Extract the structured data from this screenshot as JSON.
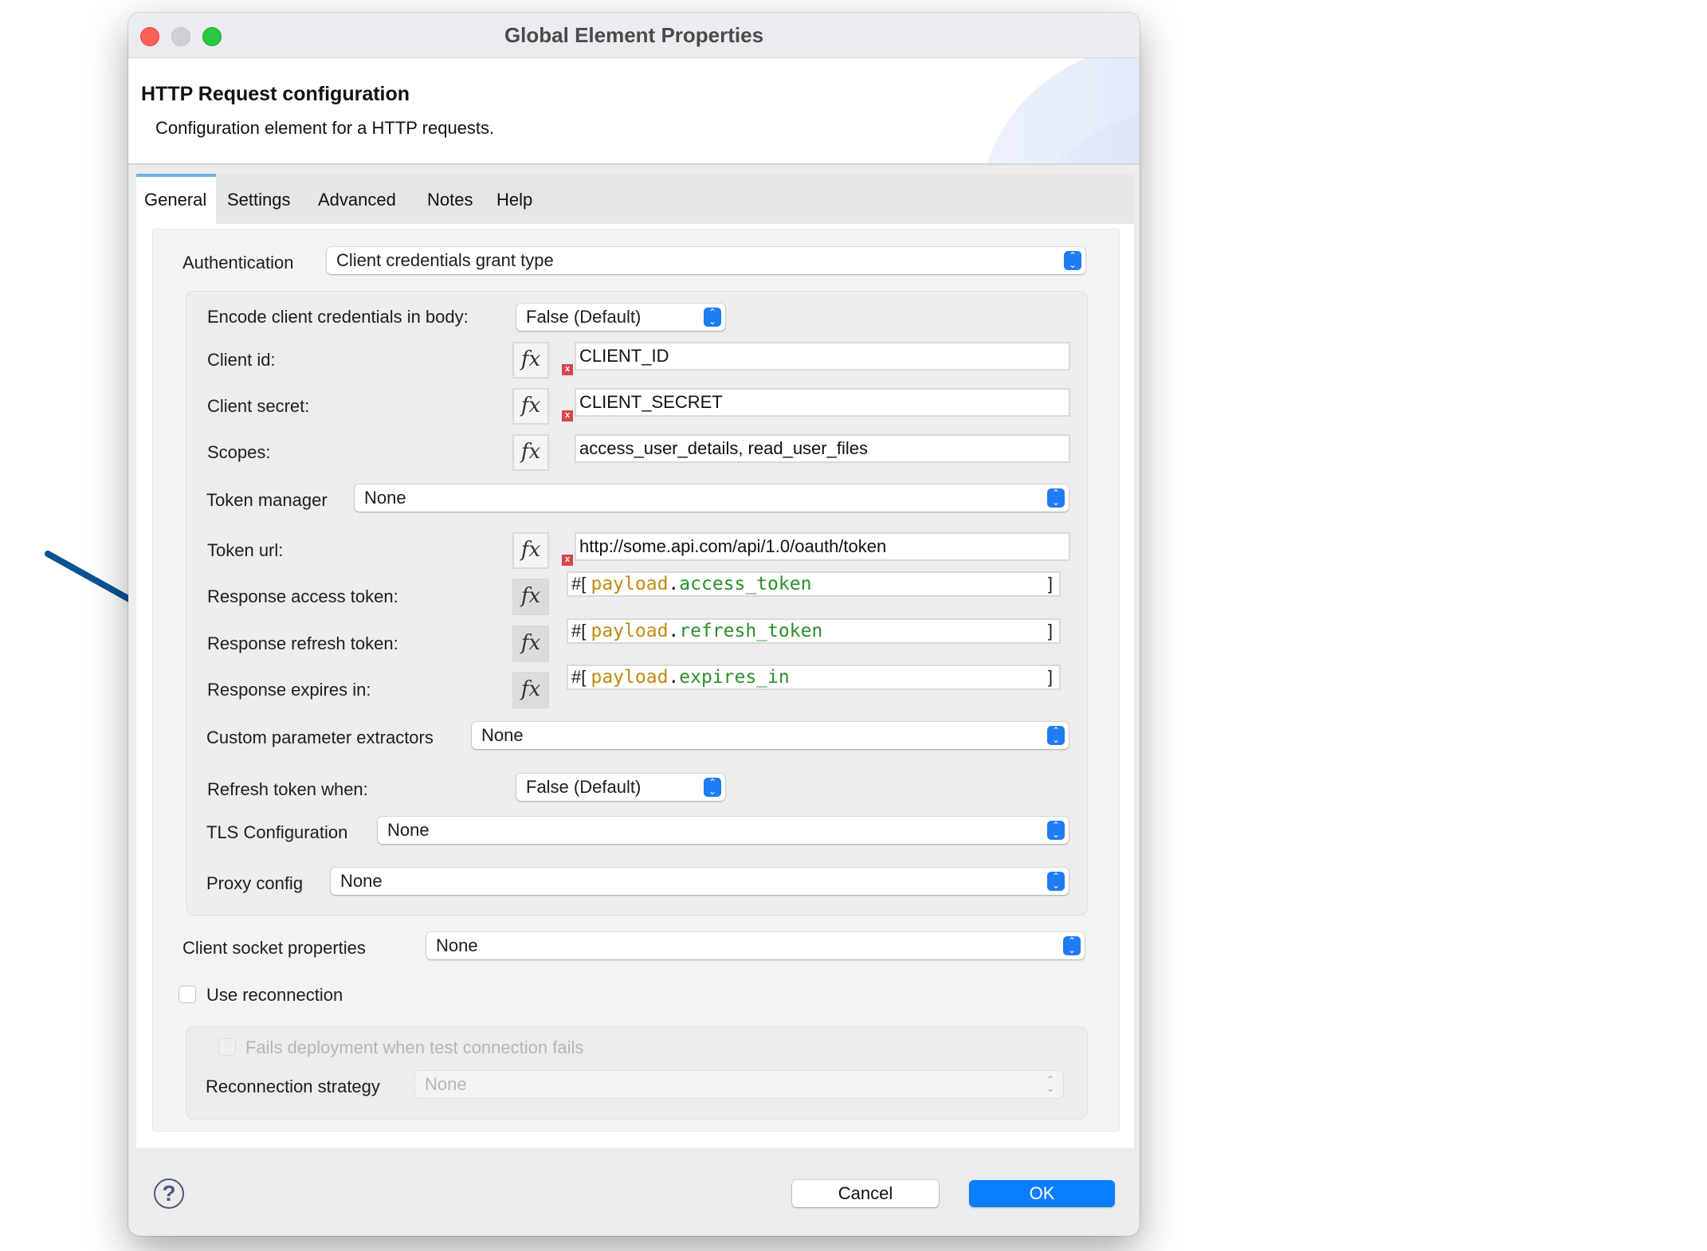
{
  "window": {
    "title": "Global Element Properties",
    "traffic_lights": {
      "close": "#fe5f57",
      "minimize": "#d0d0d4",
      "zoom": "#28c840"
    }
  },
  "header": {
    "title": "HTTP Request configuration",
    "subtitle": "Configuration element for a HTTP requests."
  },
  "tabs": [
    {
      "label": "General",
      "active": true
    },
    {
      "label": "Settings",
      "active": false
    },
    {
      "label": "Advanced",
      "active": false
    },
    {
      "label": "Notes",
      "active": false
    },
    {
      "label": "Help",
      "active": false
    }
  ],
  "form": {
    "authentication": {
      "label": "Authentication",
      "value": "Client credentials grant type"
    },
    "encode_credentials": {
      "label": "Encode client credentials in body:",
      "value": "False (Default)"
    },
    "client_id": {
      "label": "Client id:",
      "value": "CLIENT_ID",
      "error_marker": "x"
    },
    "client_secret": {
      "label": "Client secret:",
      "value": "CLIENT_SECRET",
      "error_marker": "x"
    },
    "scopes": {
      "label": "Scopes:",
      "value": "access_user_details, read_user_files"
    },
    "token_manager": {
      "label": "Token manager",
      "value": "None"
    },
    "token_url": {
      "label": "Token url:",
      "value": "http://some.api.com/api/1.0/oauth/token",
      "error_marker": "x"
    },
    "response_access_token": {
      "label": "Response access token:",
      "prefix": "#[",
      "keyword": "payload",
      "dot": ".",
      "field": "access_token",
      "suffix": "]"
    },
    "response_refresh_token": {
      "label": "Response refresh token:",
      "prefix": "#[",
      "keyword": "payload",
      "dot": ".",
      "field": "refresh_token",
      "suffix": "]"
    },
    "response_expires_in": {
      "label": "Response expires in:",
      "prefix": "#[",
      "keyword": "payload",
      "dot": ".",
      "field": "expires_in",
      "suffix": "]"
    },
    "custom_parameter_extractors": {
      "label": "Custom parameter extractors",
      "value": "None"
    },
    "refresh_token_when": {
      "label": "Refresh token when:",
      "value": "False (Default)"
    },
    "tls_configuration": {
      "label": "TLS Configuration",
      "value": "None"
    },
    "proxy_config": {
      "label": "Proxy config",
      "value": "None"
    },
    "client_socket_properties": {
      "label": "Client socket properties",
      "value": "None"
    },
    "use_reconnection": {
      "label": "Use reconnection",
      "checked": false
    },
    "fails_deployment": {
      "label": "Fails deployment when test connection fails",
      "checked": false,
      "disabled": true
    },
    "reconnection_strategy": {
      "label": "Reconnection strategy",
      "value": "None",
      "disabled": true
    }
  },
  "icons": {
    "fx": "fx",
    "stepper": "⌃⌄",
    "help": "?"
  },
  "footer": {
    "cancel_label": "Cancel",
    "ok_label": "OK"
  },
  "colors": {
    "accent": "#0a7cff",
    "tab_indicator": "#6db3e0",
    "error": "#d94452",
    "dw_keyword": "#c08a10",
    "dw_field": "#2a8f2a",
    "annotation_arrow": "#0a5394"
  }
}
